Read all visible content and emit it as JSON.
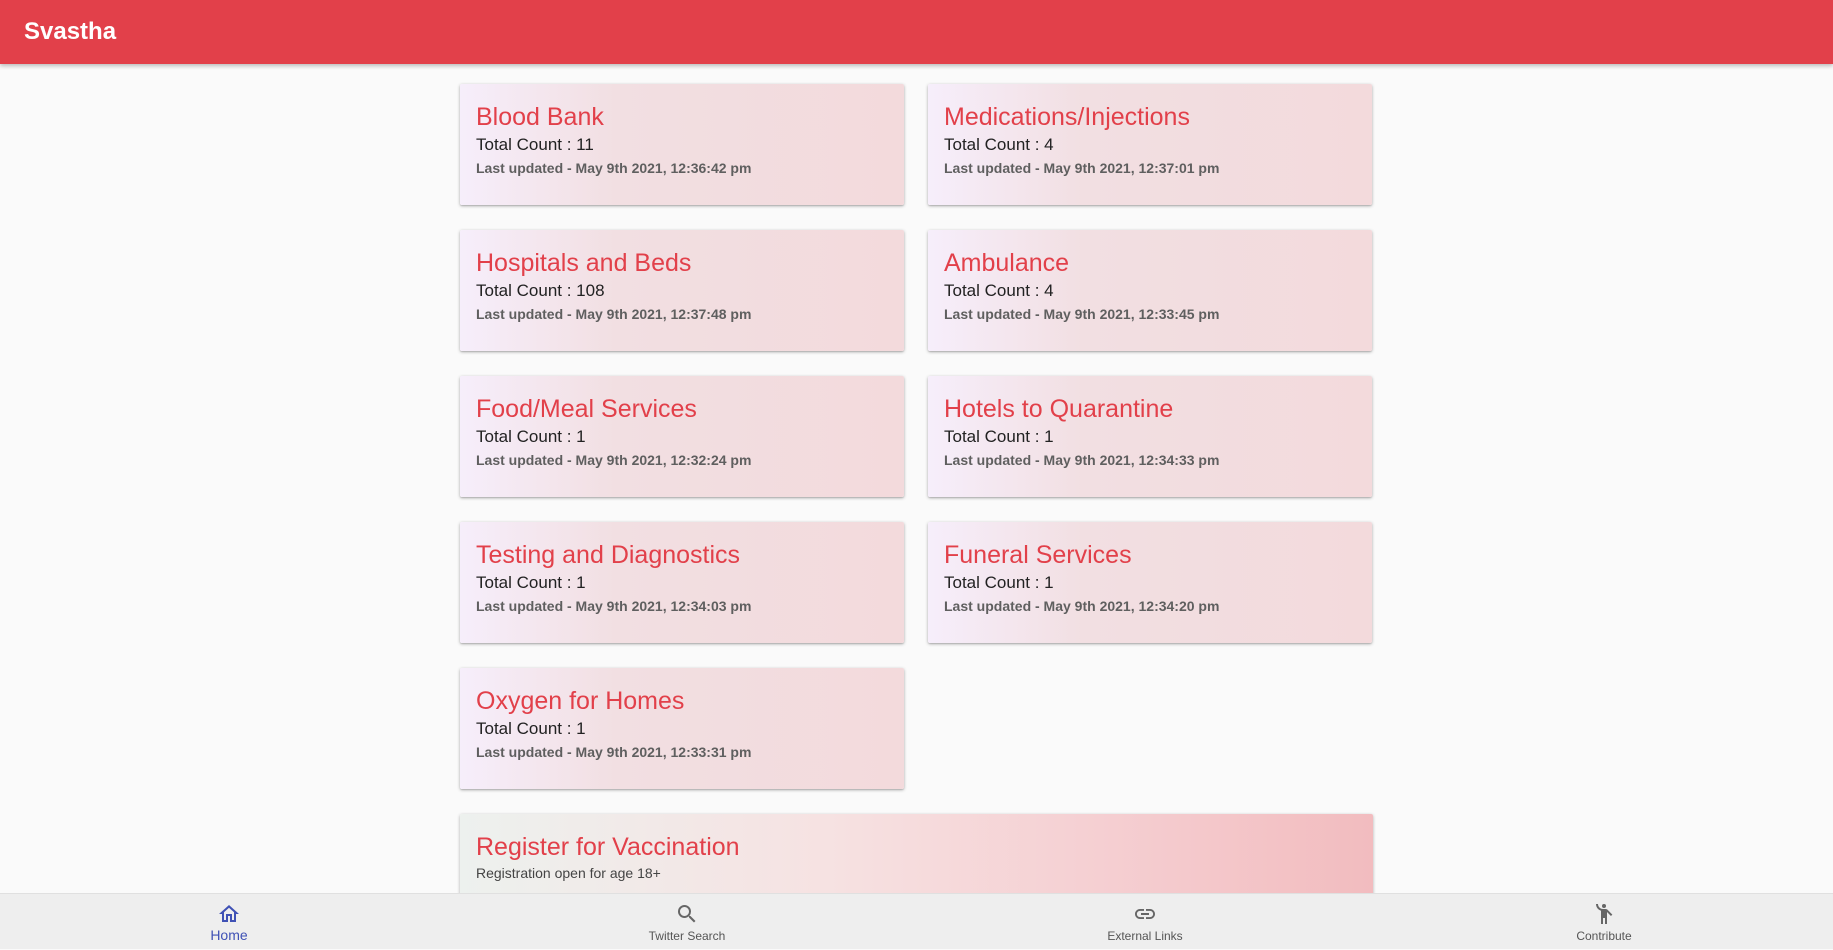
{
  "app": {
    "title": "Svastha"
  },
  "cards": [
    {
      "title": "Blood Bank",
      "count": "Total Count : 11",
      "updated": "Last updated - May 9th 2021, 12:36:42 pm"
    },
    {
      "title": "Medications/Injections",
      "count": "Total Count : 4",
      "updated": "Last updated - May 9th 2021, 12:37:01 pm"
    },
    {
      "title": "Hospitals and Beds",
      "count": "Total Count : 108",
      "updated": "Last updated - May 9th 2021, 12:37:48 pm"
    },
    {
      "title": "Ambulance",
      "count": "Total Count : 4",
      "updated": "Last updated - May 9th 2021, 12:33:45 pm"
    },
    {
      "title": "Food/Meal Services",
      "count": "Total Count : 1",
      "updated": "Last updated - May 9th 2021, 12:32:24 pm"
    },
    {
      "title": "Hotels to Quarantine",
      "count": "Total Count : 1",
      "updated": "Last updated - May 9th 2021, 12:34:33 pm"
    },
    {
      "title": "Testing and Diagnostics",
      "count": "Total Count : 1",
      "updated": "Last updated - May 9th 2021, 12:34:03 pm"
    },
    {
      "title": "Funeral Services",
      "count": "Total Count : 1",
      "updated": "Last updated - May 9th 2021, 12:34:20 pm"
    },
    {
      "title": "Oxygen for Homes",
      "count": "Total Count : 1",
      "updated": "Last updated - May 9th 2021, 12:33:31 pm"
    }
  ],
  "vaccination": {
    "title": "Register for Vaccination",
    "subtitle": "Registration open for age 18+"
  },
  "bottom_nav": {
    "items": [
      {
        "label": "Home",
        "icon": "home-icon",
        "active": true
      },
      {
        "label": "Twitter Search",
        "icon": "search-icon",
        "active": false
      },
      {
        "label": "External Links",
        "icon": "link-icon",
        "active": false
      },
      {
        "label": "Contribute",
        "icon": "person-contribute-icon",
        "active": false
      }
    ]
  },
  "colors": {
    "primary": "#e2404a",
    "nav_active": "#3f51b5",
    "background": "#fafafa"
  }
}
